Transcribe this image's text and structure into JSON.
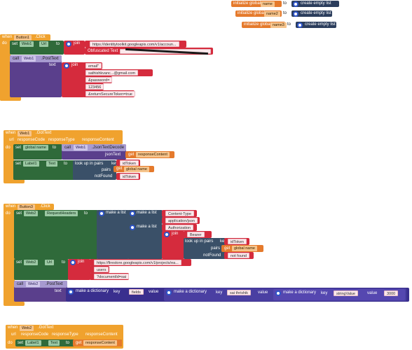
{
  "globals": [
    {
      "init_label": "initialize global",
      "name": "name",
      "to": "to",
      "value": "create empty list"
    },
    {
      "init_label": "initialize global",
      "name": "name2",
      "to": "to",
      "value": "create empty list"
    },
    {
      "init_label": "initialize global",
      "name": "name3",
      "to": "to",
      "value": "create empty list"
    }
  ],
  "button1_click": {
    "when": "when",
    "component": "Button1",
    "event": ".Click",
    "do": "do",
    "set_kw": "set",
    "set_component": "Web1",
    "set_prop": "Url",
    "to": "to",
    "join": "join",
    "url_text": "https://identitytoolkit.googleapis.com/v1/accoun...",
    "obfuscated_label": "Obfuscated Text",
    "call_kw": "call",
    "call_component": "Web1",
    "call_method": ".PostText",
    "text_arg": "text",
    "body_join": "join",
    "body_parts": [
      "email\"",
      "sathishkvanc...@gmail.com",
      "&password=",
      "123456",
      "&returnSecureToken=true"
    ]
  },
  "web1_gottext": {
    "when": "when",
    "component": "Web1",
    "event": ".GotText",
    "params": [
      "url",
      "responseCode",
      "responseType",
      "responseContent"
    ],
    "do": "do",
    "set_kw": "set",
    "global_name": "global name",
    "to": "to",
    "call_kw": "call",
    "call_component": "Web1",
    "call_method": ".JsonTextDecode",
    "json_arg": "jsonText",
    "get_kw": "get",
    "get_var": "responseContent",
    "set2_kw": "set",
    "label": "Label1",
    "label_prop": "Text",
    "to2": "to",
    "lookup": "look up in pairs",
    "key_kw": "key",
    "key_value": "idToken",
    "pairs_kw": "pairs",
    "pairs_get": "get",
    "pairs_var": "global name",
    "notfound_kw": "notFound",
    "notfound_value": "idToken"
  },
  "button3_click": {
    "when": "when",
    "component": "Button3",
    "event": ".Click",
    "do": "do",
    "set_kw": "set",
    "set_component": "Web2",
    "set_prop": "RequestHeaders",
    "to": "to",
    "make_list": "make a list",
    "row1": {
      "make_list": "make a list",
      "items": [
        "Content-Type",
        "application/json"
      ]
    },
    "row2": {
      "make_list": "make a list",
      "item1": "Authorization",
      "join": "join",
      "bearer": "Bearer ",
      "lookup": "look up in pairs",
      "key_kw": "key",
      "key_value": "idToken",
      "pairs_kw": "pairs",
      "pairs_get": "get",
      "pairs_var": "global name",
      "notfound_kw": "notFound",
      "notfound_value": "not found"
    },
    "set2_kw": "set",
    "set2_component": "Web2",
    "set2_prop": "Url",
    "to2": "to",
    "join2": "join",
    "url_parts": [
      "https://firestore.googleapis.com/v1/projects/ea...",
      "users",
      "?documentId=sai"
    ],
    "call_kw": "call",
    "call_component": "Web2",
    "call_method": ".PostText",
    "text_arg": "text",
    "dict1": "make a dictionary",
    "key1": "key",
    "key1_value": "fields",
    "value1": "value",
    "dict2": "make a dictionary",
    "key2": "key",
    "key2_value": "sai thrishik",
    "value2": "value",
    "dict3": "make a dictionary",
    "key3": "key",
    "key3_value": "stringValue",
    "value3": "value",
    "value3_value": "3000"
  },
  "web2_gottext": {
    "when": "when",
    "component": "Web2",
    "event": ".GotText",
    "params": [
      "url",
      "responseCode",
      "responseType",
      "responseContent"
    ],
    "do": "do",
    "set_kw": "set",
    "label": "Label1",
    "label_prop": "Text",
    "to": "to",
    "get_kw": "get",
    "get_var": "responseContent"
  }
}
